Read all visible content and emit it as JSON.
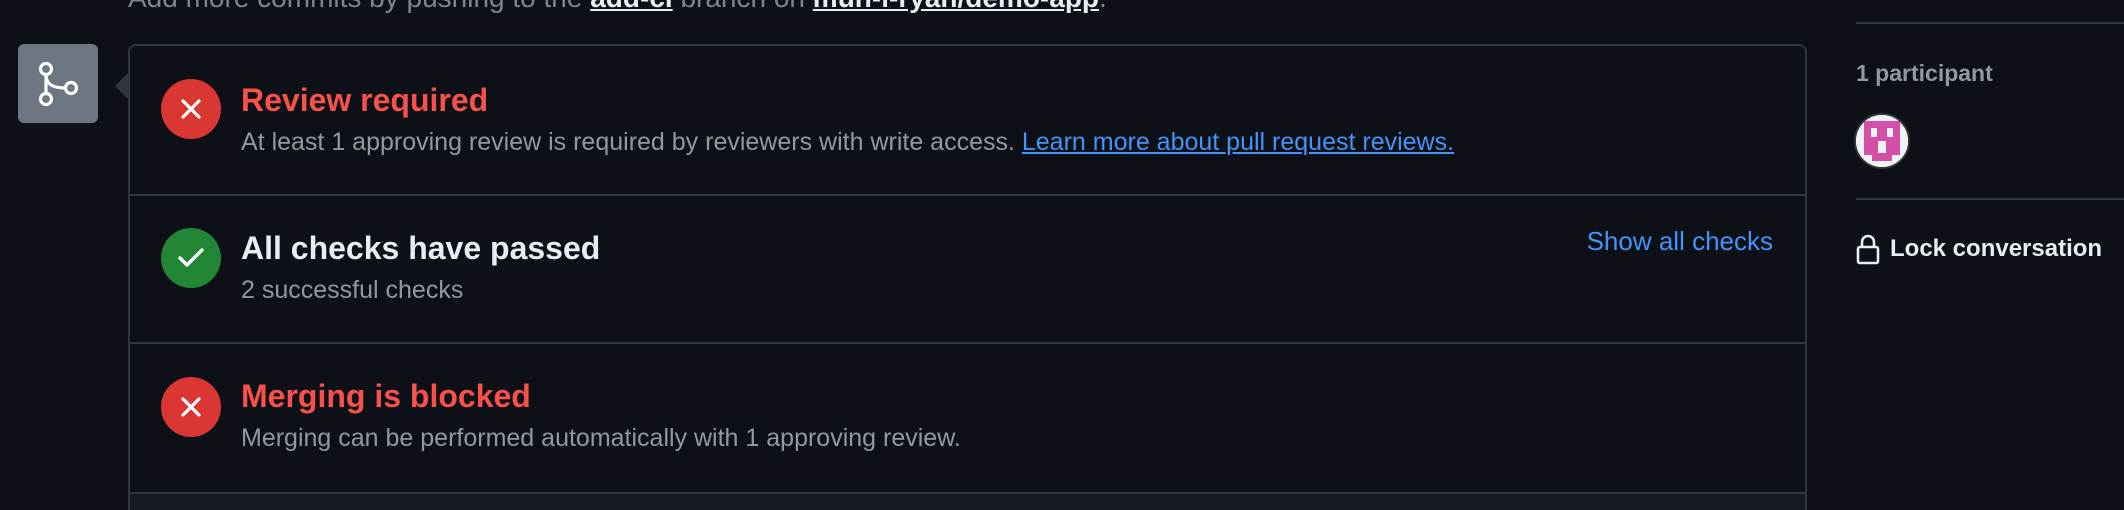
{
  "top_line": {
    "prefix": "Add more commits by pushing to the ",
    "branch": "add-ci",
    "middle": " branch on ",
    "repo": "mun-i-ryan/demo-app",
    "suffix": "."
  },
  "merge_box": {
    "icon": "git-merge-icon"
  },
  "checks": [
    {
      "status": "failure",
      "icon": "x-icon",
      "title": "Review required",
      "description": "At least 1 approving review is required by reviewers with write access. ",
      "link": "Learn more about pull request reviews."
    },
    {
      "status": "success",
      "icon": "check-icon",
      "title": "All checks have passed",
      "description": "2 successful checks",
      "action": "Show all checks"
    },
    {
      "status": "failure",
      "icon": "x-icon",
      "title": "Merging is blocked",
      "description": "Merging can be performed automatically with 1 approving review."
    }
  ],
  "sidebar": {
    "participants_label": "1 participant",
    "lock_icon": "lock-icon",
    "lock_label": "Lock conversation"
  },
  "colors": {
    "background": "#0d1117",
    "border": "#30363d",
    "danger": "#f85149",
    "danger_bg": "#da3633",
    "success_bg": "#238636",
    "link": "#4493f8",
    "muted": "#9198a1"
  }
}
